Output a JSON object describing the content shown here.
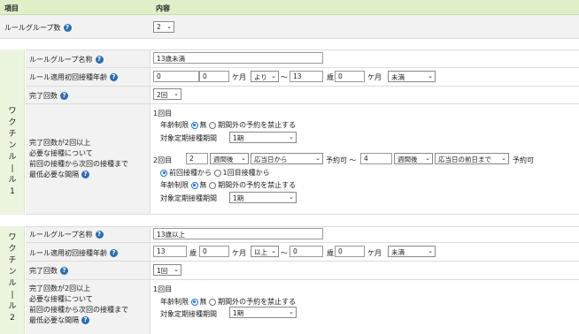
{
  "header": {
    "col1": "項目",
    "col2": "内容"
  },
  "rule_group_count": {
    "label": "ルールグループ数",
    "value": "2"
  },
  "groups": [
    {
      "vlabel": "ワクチンルール1",
      "name_label": "ルールグループ名称",
      "name_value": "13歳未満",
      "age_label": "ルール適用初回接種年齢",
      "age_from_years": "0",
      "age_years_unit": "歳",
      "age_from_months": "0",
      "age_months_unit": "ケ月",
      "age_from_cond": "より",
      "tilde": "〜",
      "age_to_years": "13",
      "age_to_months": "0",
      "age_to_cond": "未満",
      "done_label": "完了回数",
      "done_value": "2回",
      "interval_label": [
        "完了回数が2回以上",
        "必要な接種について",
        "前回の接種から次回の接種まで",
        "最低必要な間隔"
      ],
      "dose1": {
        "title": "1回目",
        "age_limit_label": "年齢制限",
        "opt_none": "無",
        "opt_forbid": "期間外の予約を禁止する",
        "period_label": "対象定期接種期間",
        "period_value": "1期"
      },
      "dose2": {
        "title": "2回目",
        "n1": "2",
        "unit1": "週間後",
        "base1": "応当日から",
        "rsv_from": "予約可 〜",
        "n2": "4",
        "unit2": "週間後",
        "base2": "応当日の前日まで",
        "rsv_to": "予約可",
        "opt_prev": "前回接種から",
        "opt_first": "1回目接種から",
        "age_limit_label": "年齢制限",
        "opt_none": "無",
        "opt_forbid": "期間外の予約を禁止する",
        "period_label": "対象定期接種期間",
        "period_value": "1期"
      }
    },
    {
      "vlabel": "ワクチンルール2",
      "name_label": "ルールグループ名称",
      "name_value": "13歳以上",
      "age_label": "ルール適用初回接種年齢",
      "age_from_years": "13",
      "age_years_unit": "歳",
      "age_from_months": "0",
      "age_months_unit": "ケ月",
      "age_from_cond": "以上",
      "tilde": "〜",
      "age_to_years": "0",
      "age_to_months": "0",
      "age_to_cond": "未満",
      "done_label": "完了回数",
      "done_value": "1回",
      "interval_label": [
        "完了回数が2回以上",
        "必要な接種について",
        "前回の接種から次回の接種まで",
        "最低必要な間隔"
      ],
      "dose1": {
        "title": "1回目",
        "age_limit_label": "年齢制限",
        "opt_none": "無",
        "opt_forbid": "期間外の予約を禁止する",
        "period_label": "対象定期接種期間",
        "period_value": "1期"
      }
    }
  ]
}
